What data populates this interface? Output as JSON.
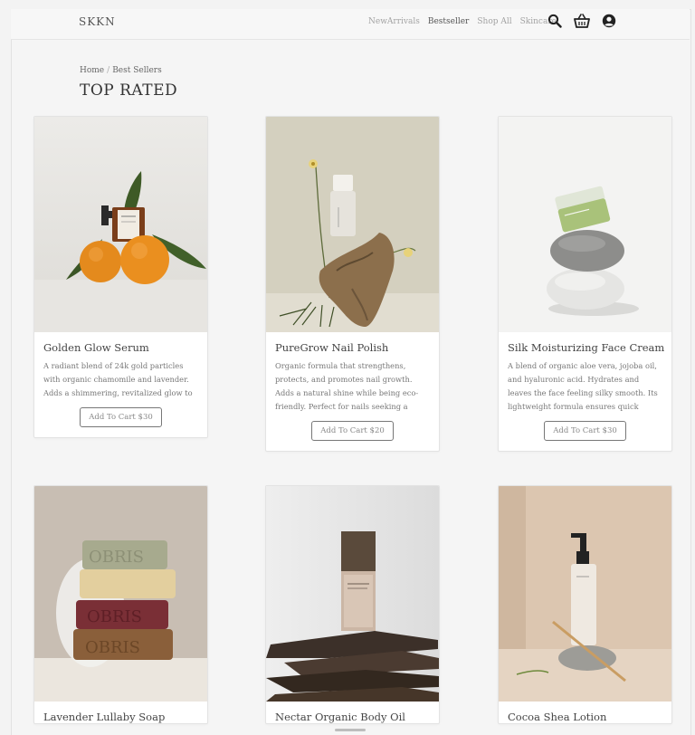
{
  "nav": {
    "brand": "SKKN",
    "links": [
      "NewArrivals",
      "Bestseller",
      "Shop All",
      "Skincare"
    ],
    "icons": [
      "search-icon",
      "basket-icon",
      "user-icon"
    ]
  },
  "breadcrumb": {
    "home": "Home",
    "separator": "/",
    "current": "Best Sellers"
  },
  "page_title": "TOP RATED",
  "products": [
    {
      "name": "Golden Glow Serum",
      "description": "A radiant blend of 24k gold particles with organic chamomile and lavender. Adds a shimmering, revitalized glow to your skin.",
      "button": "Add To Cart  $30"
    },
    {
      "name": "PureGrow Nail Polish",
      "description": "Organic formula that strengthens, protects, and promotes nail growth. Adds a natural shine while being eco-friendly. Perfect for nails seeking a growth boost.",
      "button": "Add To Cart  $20"
    },
    {
      "name": "Silk Moisturizing Face Cream",
      "description": "A blend of organic aloe vera, jojoba oil, and hyaluronic acid. Hydrates and leaves the face feeling silky smooth. Its lightweight formula ensures quick absorption",
      "button": "Add To Cart  $30"
    },
    {
      "name": "Lavender Lullaby Soap",
      "description": "",
      "button": ""
    },
    {
      "name": "Nectar Organic Body Oil",
      "description": "",
      "button": ""
    },
    {
      "name": "Cocoa Shea Lotion",
      "description": "",
      "button": ""
    }
  ],
  "colors": {
    "background": "#f5f5f5",
    "card": "#ffffff",
    "text": "#444444",
    "muted": "#a3a3a3"
  }
}
